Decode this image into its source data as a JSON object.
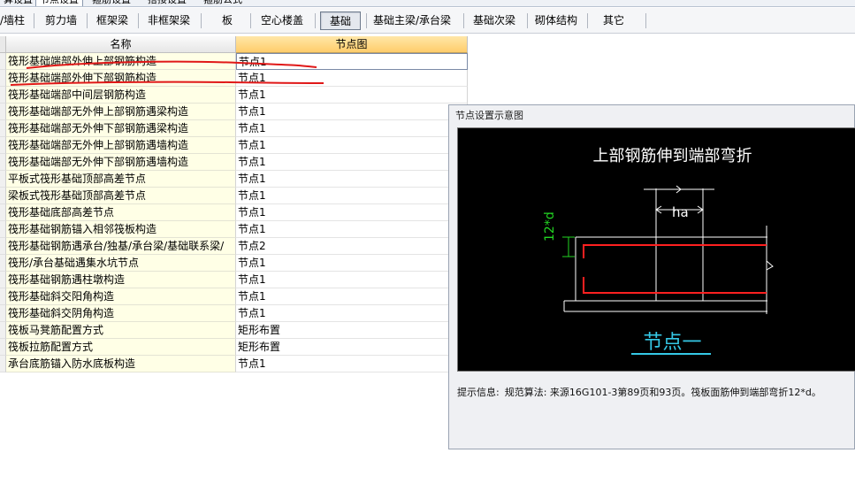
{
  "top_tabs": [
    "算设置",
    "节点设置",
    "箍筋设置",
    "搭接设置",
    "箍筋公式"
  ],
  "top_tab_active": 1,
  "categories": [
    "/墙柱",
    "剪力墙",
    "框架梁",
    "非框架梁",
    "板",
    "空心楼盖",
    "基础",
    "基础主梁/承台梁",
    "基础次梁",
    "砌体结构",
    "其它"
  ],
  "category_active": 6,
  "grid": {
    "headers": {
      "name": "名称",
      "node": "节点图"
    },
    "rows": [
      {
        "name": "筏形基础端部外伸上部钢筋构造",
        "value": "节点1"
      },
      {
        "name": "筏形基础端部外伸下部钢筋构造",
        "value": "节点1"
      },
      {
        "name": "筏形基础端部中间层钢筋构造",
        "value": "节点1"
      },
      {
        "name": "筏形基础端部无外伸上部钢筋遇梁构造",
        "value": "节点1"
      },
      {
        "name": "筏形基础端部无外伸下部钢筋遇梁构造",
        "value": "节点1"
      },
      {
        "name": "筏形基础端部无外伸上部钢筋遇墙构造",
        "value": "节点1"
      },
      {
        "name": "筏形基础端部无外伸下部钢筋遇墙构造",
        "value": "节点1"
      },
      {
        "name": "平板式筏形基础顶部高差节点",
        "value": "节点1"
      },
      {
        "name": "梁板式筏形基础顶部高差节点",
        "value": "节点1"
      },
      {
        "name": "筏形基础底部高差节点",
        "value": "节点1"
      },
      {
        "name": "筏形基础钢筋锚入相邻筏板构造",
        "value": "节点1"
      },
      {
        "name": "筏形基础钢筋遇承台/独基/承台梁/基础联系梁/",
        "value": "节点2"
      },
      {
        "name": "筏形/承台基础遇集水坑节点",
        "value": "节点1"
      },
      {
        "name": "筏形基础钢筋遇柱墩构造",
        "value": "节点1"
      },
      {
        "name": "筏形基础斜交阳角构造",
        "value": "节点1"
      },
      {
        "name": "筏形基础斜交阴角构造",
        "value": "节点1"
      },
      {
        "name": "筏板马凳筋配置方式",
        "value": "矩形布置"
      },
      {
        "name": "筏板拉筋配置方式",
        "value": "矩形布置"
      },
      {
        "name": "承台底筋锚入防水底板构造",
        "value": "节点1"
      }
    ]
  },
  "panel": {
    "title": "节点设置示意图",
    "diagram_title": "上部钢筋伸到端部弯折",
    "dim_ha": "ha",
    "dim_12d": "12*d",
    "node_label": "节点一",
    "hint_label": "提示信息:",
    "hint_text": "规范算法: 来源16G101-3第89页和93页。筏板面筋伸到端部弯折12*d。"
  },
  "colors": {
    "rebar": "#ff2020",
    "annotation_underline": "#e01818",
    "node_label": "#35c8e6",
    "dim_green": "#22d422",
    "header_orange": "#ffcd6b"
  }
}
